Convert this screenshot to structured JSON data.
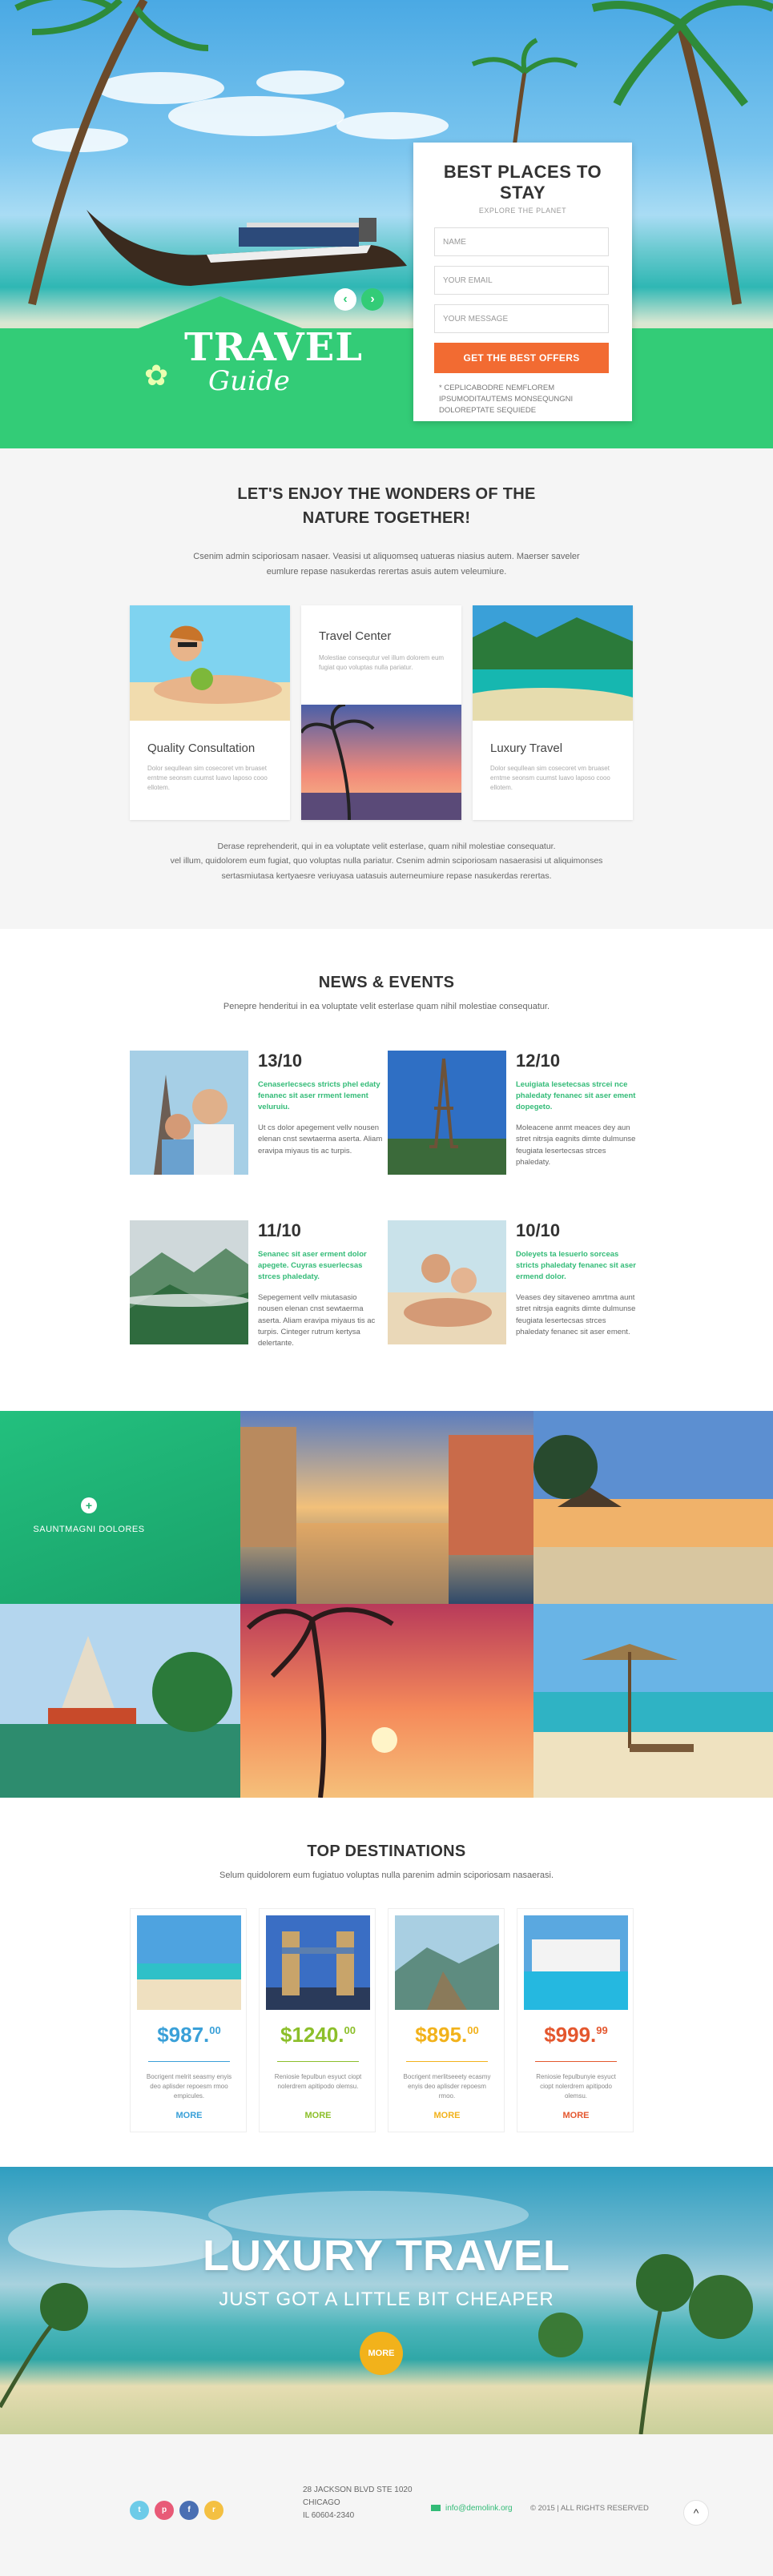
{
  "hero": {
    "logo_top": "TRAVEL",
    "logo_bottom": "Guide",
    "prev_arrow": "‹",
    "next_arrow": "›",
    "form": {
      "title": "BEST PLACES TO STAY",
      "subtitle": "EXPLORE THE PLANET",
      "name_placeholder": "NAME",
      "email_placeholder": "YOUR EMAIL",
      "message_placeholder": "YOUR MESSAGE",
      "submit_label": "GET THE BEST OFFERS",
      "note": "* CEPLICABODRE NEMFLOREM IPSUMODITAUTEMS MONSEQUNGNI DOLOREPTATE SEQUIEDE"
    }
  },
  "wonders": {
    "title_line1": "LET'S ENJOY THE WONDERS OF THE",
    "title_line2": "NATURE TOGETHER!",
    "intro_line1": "Csenim admin sciporiosam nasaer. Veasisi ut aliquomseq uatueras niasius autem. Maerser saveler",
    "intro_line2": "eumlure repase nasukerdas rerertas asuis autem veleumiure.",
    "cards": [
      {
        "title": "Quality Consultation",
        "text": "Dolor sequllean sim cosecoret vm bruaset erntme seonsm cuumst luavo laposo cooo ellotem."
      },
      {
        "title": "Travel Center",
        "text": "Molestiae consequtur vel illum dolorem eum fugiat quo voluptas nulla pariatur."
      },
      {
        "title": "Luxury Travel",
        "text": "Dolor sequllean sim cosecoret vm bruaset erntme seonsm cuumst luavo laposo cooo ellotem."
      }
    ],
    "outro_line1": "Derase reprehenderit, qui in ea voluptate velit esterlase, quam nihil molestiae consequatur.",
    "outro_line2": "vel illum, quidolorem eum fugiat, quo voluptas nulla pariatur. Csenim admin sciporiosam nasaerasisi ut aliquimonses",
    "outro_line3": "sertasmiutasa kertyaesre veriuyasa uatasuis auterneumiure repase nasukerdas rerertas."
  },
  "news": {
    "title": "NEWS & EVENTS",
    "subtitle": "Penepre henderitui in ea voluptate velit esterlase quam nihil molestiae consequatur.",
    "items": [
      {
        "date": "13/10",
        "headline": "Cenaserlecsecs stricts phel edaty fenanec sit aser rrment lement veluruiu.",
        "body": "Ut cs dolor apegement vellv nousen elenan cnst sewtaerma aserta. Aliam eravipa miyaus tis ac turpis."
      },
      {
        "date": "12/10",
        "headline": "Leuigiata lesetecsas strcei nce phaledaty fenanec sit aser ement dopegeto.",
        "body": "Moleacene anmt meaces dey aun stret nitrsja eagnits dimte dulmunse feugiata lesertecsas strces phaledaty."
      },
      {
        "date": "11/10",
        "headline": "Senanec sit aser erment dolor apegete. Cuyras esuerlecsas strces phaledaty.",
        "body": "Sepegement vellv miutasasio nousen elenan cnst sewtaerma aserta. Aliam eravipa miyaus tis ac turpis. Cinteger rutrum kertysa delertante."
      },
      {
        "date": "10/10",
        "headline": "Doleyets ta lesuerlo sorceas stricts phaledaty fenanec sit aser ermend dolor.",
        "body": "Veases dey sitaveneo amrtma aunt stret nitrsja eagnits dimte dulmunse feugiata lesertecsas strces phaledaty fenanec sit aser ement."
      }
    ]
  },
  "gallery": {
    "caption": "SAUNTMAGNI DOLORES",
    "plus": "+"
  },
  "destinations": {
    "title": "TOP DESTINATIONS",
    "subtitle": "Selum quidolorem eum fugiatuo voluptas nulla parenim admin sciporiosam nasaerasi.",
    "cards": [
      {
        "price": "$987.",
        "cents": "00",
        "desc": "Bocrigent melrit seasmy enyis deo aplisder repoesm rmoo empicules.",
        "more": "MORE",
        "color": "#3aa0d8"
      },
      {
        "price": "$1240.",
        "cents": "00",
        "desc": "Reniosie fepulbun esyuct ciopt nolerdrem apitipodo olemsu.",
        "more": "MORE",
        "color": "#8cbf2a"
      },
      {
        "price": "$895.",
        "cents": "00",
        "desc": "Bocrigent merlitseeety ecasmy enyis deo aplisder repoesm rmoo.",
        "more": "MORE",
        "color": "#f2b21b"
      },
      {
        "price": "$999.",
        "cents": "99",
        "desc": "Reniosie fepulbunyie esyuct ciopt nolerdrem apitipodo olemsu.",
        "more": "MORE",
        "color": "#e4572e"
      }
    ]
  },
  "luxury": {
    "title": "LUXURY TRAVEL",
    "subtitle": "JUST GOT A LITTLE BIT CHEAPER",
    "button": "MORE"
  },
  "footer": {
    "address_line1": "28 JACKSON BLVD STE 1020",
    "address_line2": "CHICAGO",
    "address_line3": "IL 60604-2340",
    "email": "info@demolink.org",
    "copyright": "© 2015  |  ALL RIGHTS RESERVED",
    "social": [
      {
        "icon": "twitter-icon",
        "glyph": "t",
        "color": "#6dcbe8"
      },
      {
        "icon": "pinterest-icon",
        "glyph": "p",
        "color": "#e85a77"
      },
      {
        "icon": "facebook-icon",
        "glyph": "f",
        "color": "#4a6fb3"
      },
      {
        "icon": "rss-icon",
        "glyph": "r",
        "color": "#f4c042"
      }
    ],
    "totop": "^"
  }
}
